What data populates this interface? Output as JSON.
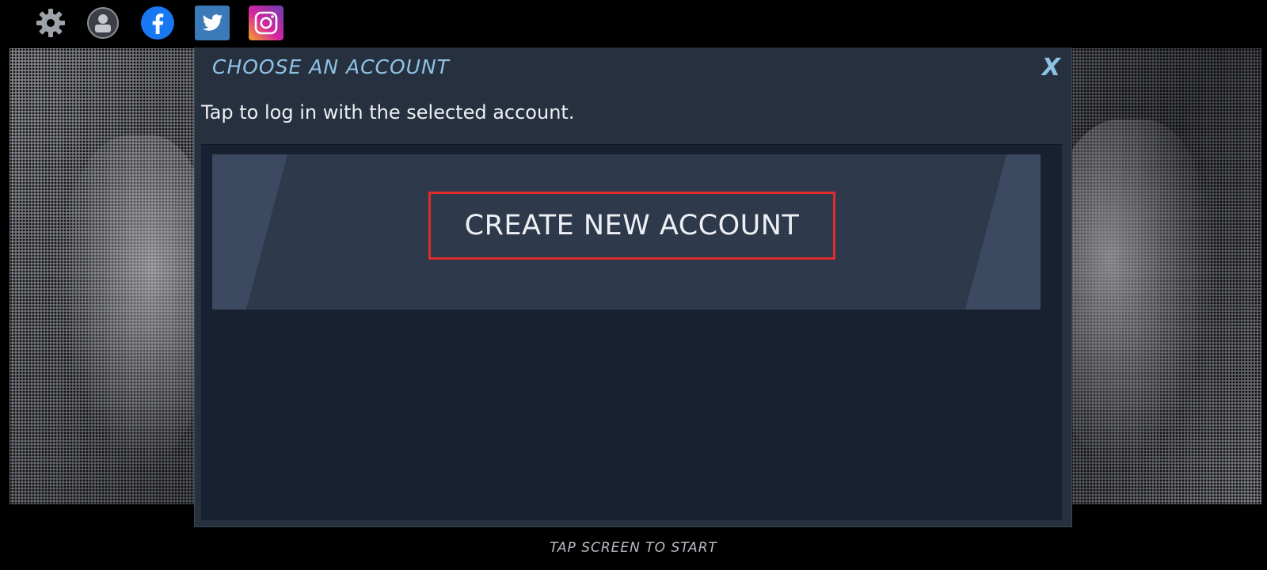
{
  "topbar": {
    "icons": [
      {
        "name": "settings-gear-icon"
      },
      {
        "name": "profile-icon"
      },
      {
        "name": "facebook-icon"
      },
      {
        "name": "twitter-icon"
      },
      {
        "name": "instagram-icon"
      }
    ]
  },
  "dialog": {
    "title": "CHOOSE AN ACCOUNT",
    "close_label": "X",
    "subtitle": "Tap to log in with the selected account.",
    "create_account_label": "CREATE NEW ACCOUNT"
  },
  "footer": {
    "tap_to_start": "TAP SCREEN TO START"
  },
  "colors": {
    "dialog_bg": "#26303f",
    "title_accent": "#8ec2e4",
    "list_bg": "#172131",
    "card_bg": "#2e3a4b",
    "highlight_box": "#e02b2b",
    "facebook_blue": "#1877f2",
    "twitter_blue": "#3a7ab8",
    "instagram_pink": "#c13584"
  }
}
